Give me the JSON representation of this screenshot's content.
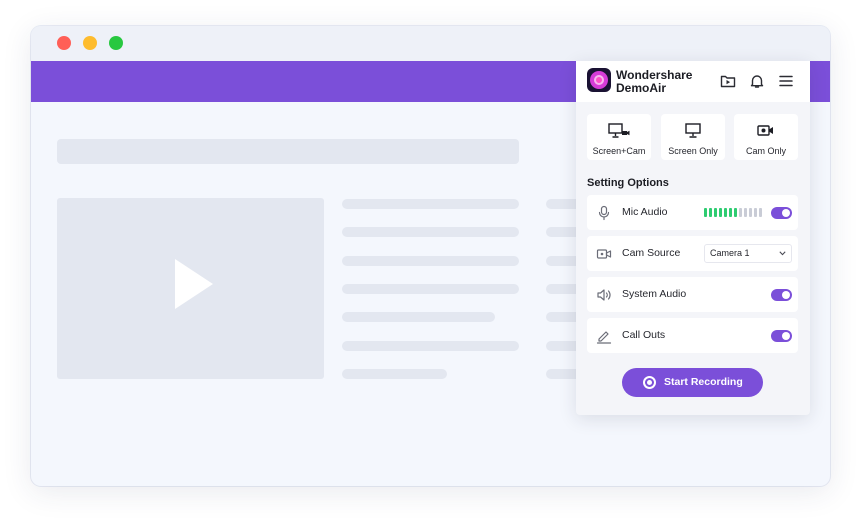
{
  "colors": {
    "accent": "#7b4fd9",
    "mic_level_active": "#2ecc71",
    "mic_level_inactive": "#c9ccd6"
  },
  "window": {
    "traffic_lights": [
      "close",
      "minimize",
      "maximize"
    ]
  },
  "panel": {
    "brand_line1": "Wondershare",
    "brand_line2": "DemoAir",
    "header_icons": [
      "video-folder-icon",
      "bell-icon",
      "menu-icon"
    ],
    "modes": [
      {
        "label": "Screen+Cam",
        "icon": "screen-cam-icon"
      },
      {
        "label": "Screen Only",
        "icon": "monitor-icon"
      },
      {
        "label": "Cam Only",
        "icon": "camera-icon"
      }
    ],
    "settings_title": "Setting Options",
    "settings": {
      "mic_audio": {
        "label": "Mic Audio",
        "icon": "microphone-icon",
        "enabled": true,
        "level_bars": 12,
        "level_active": 7
      },
      "cam_source": {
        "label": "Cam Source",
        "icon": "video-camera-icon",
        "value": "Camera 1"
      },
      "system_audio": {
        "label": "System Audio",
        "icon": "speaker-icon",
        "enabled": true
      },
      "call_outs": {
        "label": "Call Outs",
        "icon": "pen-icon",
        "enabled": true
      }
    },
    "start_button": "Start Recording"
  }
}
